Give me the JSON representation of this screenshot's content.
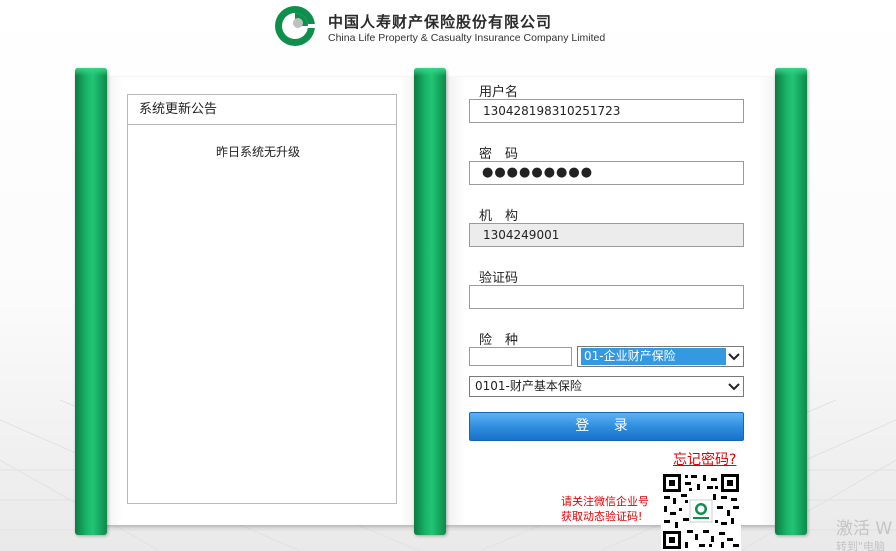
{
  "header": {
    "company_cn": "中国人寿财产保险股份有限公司",
    "company_en": "China Life Property & Casualty Insurance Company Limited"
  },
  "notice": {
    "title": "系统更新公告",
    "body": "昨日系统无升级"
  },
  "form": {
    "username_label": "用户名",
    "username_value": "130428198310251723",
    "password_label": "密　码",
    "password_value": "●●●●●●●●●",
    "org_label": "机　构",
    "org_value": "1304249001",
    "captcha_label": "验证码",
    "captcha_value": "",
    "insurance_label": "险　种",
    "insurance_code_value": "",
    "insurance_type_selected": "01-企业财产保险",
    "product_selected": "0101-财产基本保险",
    "login_button": "登 录",
    "forgot_link": "忘记密码?",
    "qr_note_line1": "请关注微信企业号",
    "qr_note_line2": "获取动态验证码!"
  },
  "watermark": {
    "line1": "激活 W",
    "line2": "转到\"电脑"
  },
  "colors": {
    "brand_green": "#18b367",
    "button_blue": "#2f8ee0",
    "alert_red": "#e00000",
    "select_highlight": "#3399e0"
  }
}
